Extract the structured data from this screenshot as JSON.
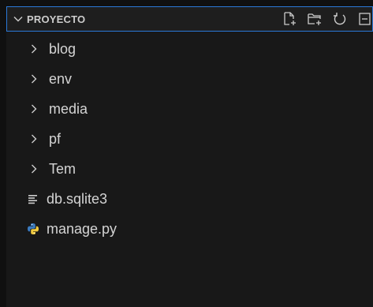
{
  "explorer": {
    "section_title": "PROYECTO",
    "actions": [
      {
        "name": "new-file-icon"
      },
      {
        "name": "new-folder-icon"
      },
      {
        "name": "refresh-icon"
      },
      {
        "name": "collapse-all-icon"
      }
    ],
    "items": [
      {
        "type": "folder",
        "label": "blog"
      },
      {
        "type": "folder",
        "label": "env"
      },
      {
        "type": "folder",
        "label": "media"
      },
      {
        "type": "folder",
        "label": "pf"
      },
      {
        "type": "folder",
        "label": "Tem"
      },
      {
        "type": "file",
        "label": "db.sqlite3",
        "icon": "database-file-icon"
      },
      {
        "type": "file",
        "label": "manage.py",
        "icon": "python-file-icon"
      }
    ]
  },
  "colors": {
    "background": "#181818",
    "header_bg": "#1e1e1e",
    "focus_border": "#2b79d8",
    "text": "#cccccc",
    "python_blue": "#3b7bbf",
    "python_yellow": "#f0c93d"
  }
}
